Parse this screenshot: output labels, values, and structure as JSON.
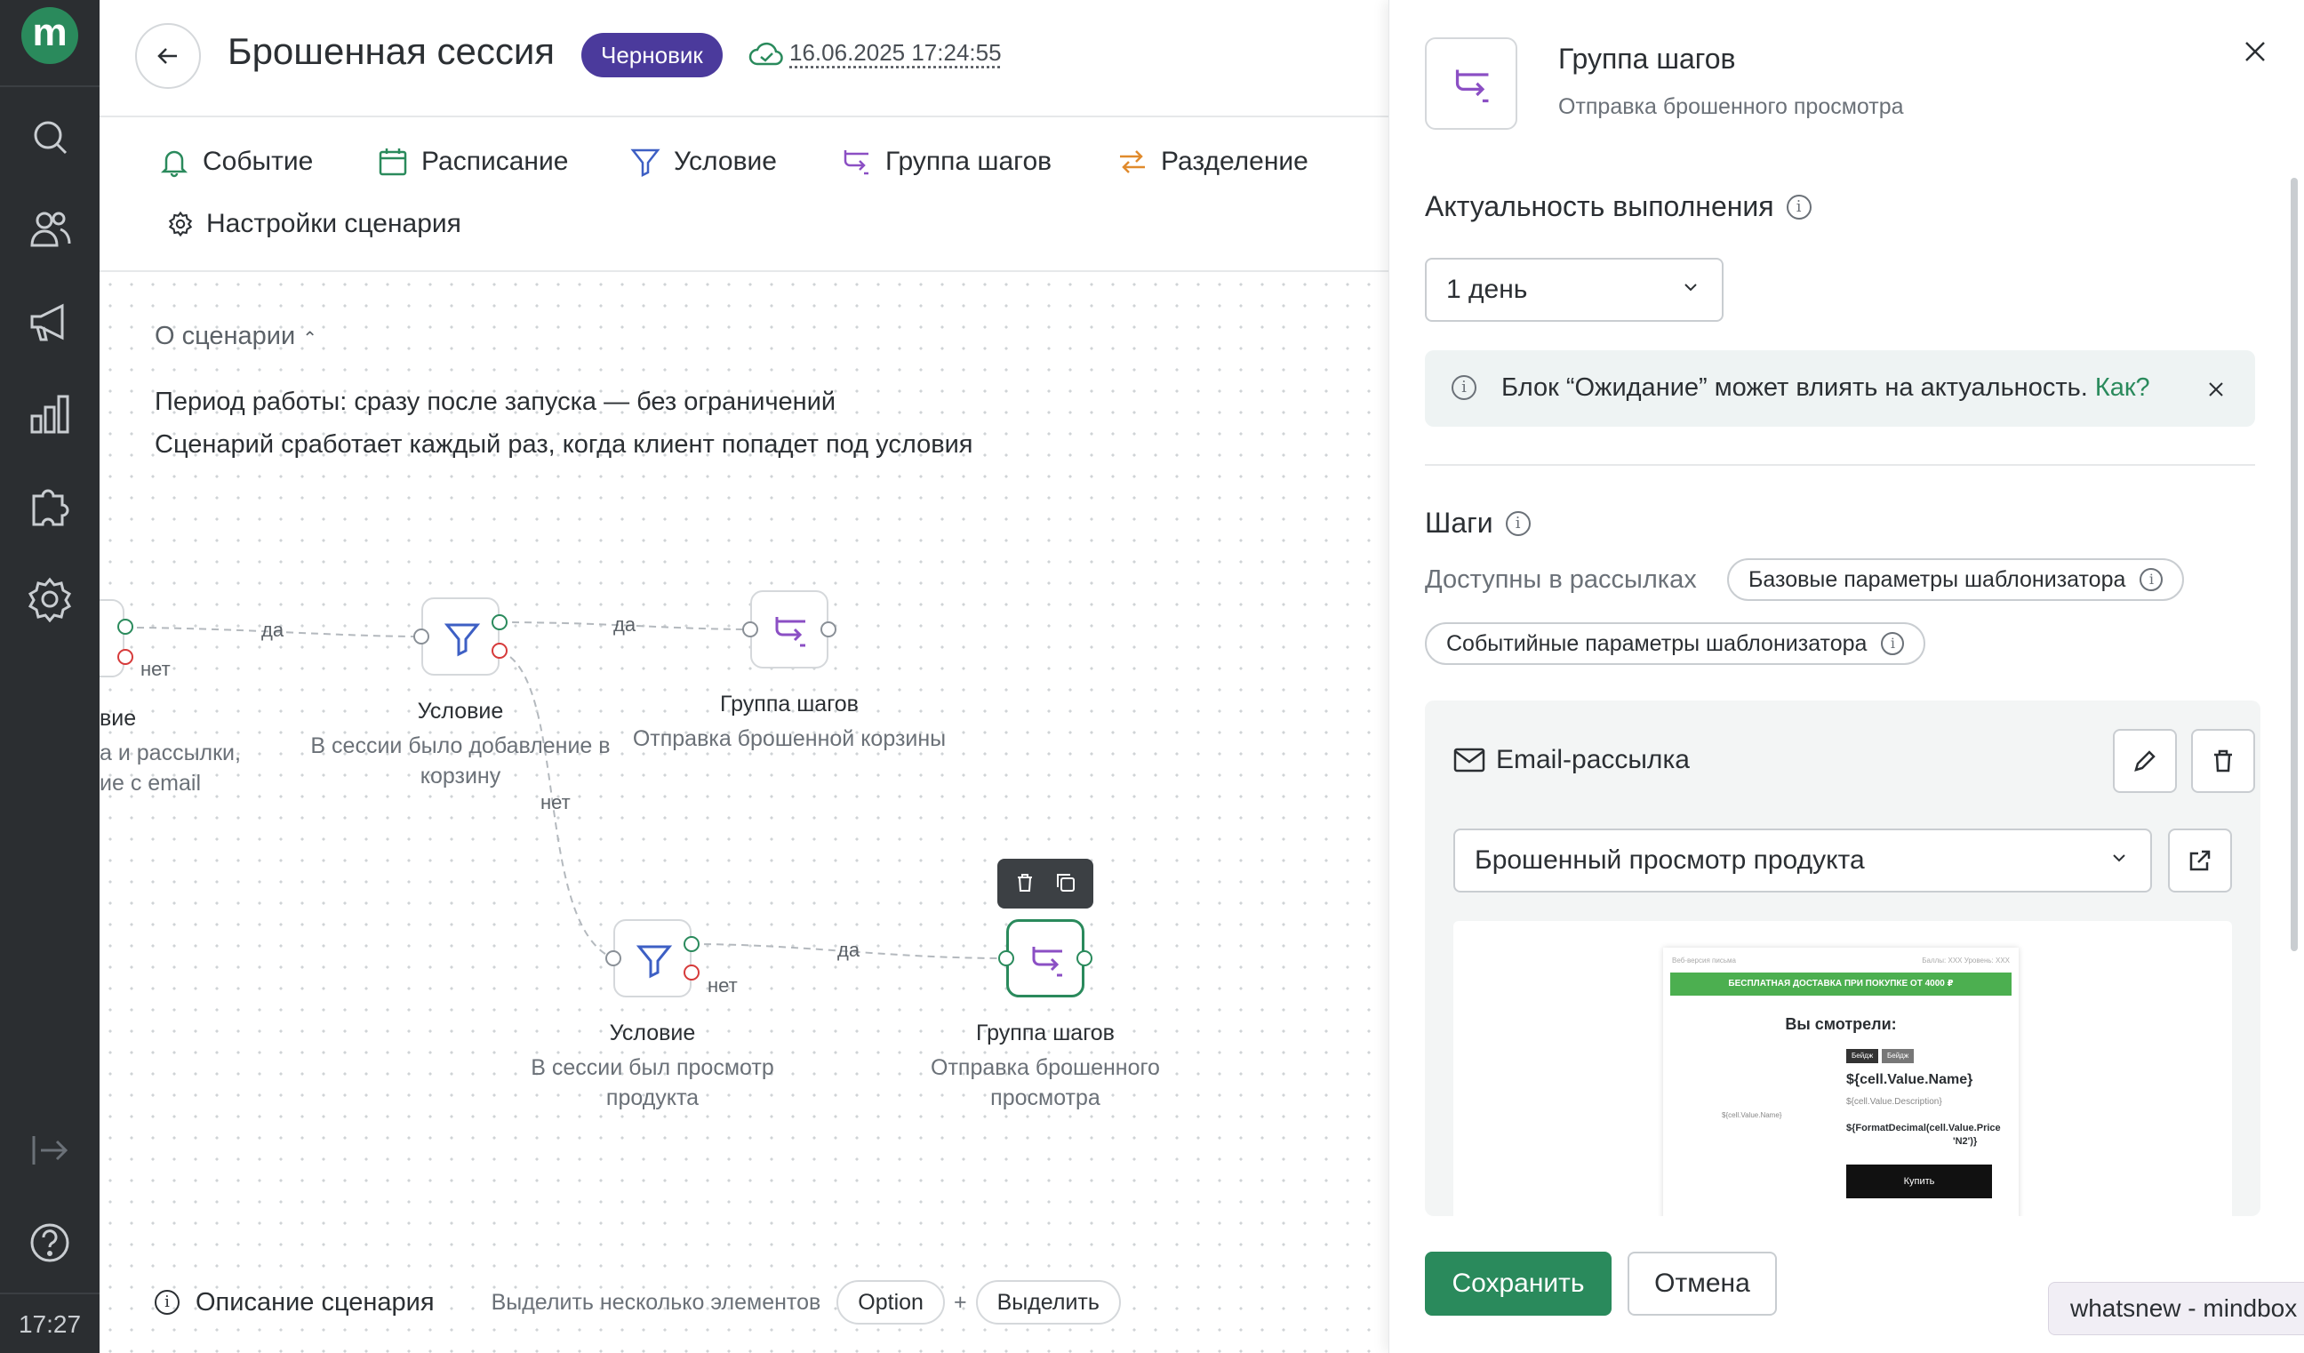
{
  "sidebar": {
    "logo": "m",
    "icons": [
      "search-icon",
      "users-icon",
      "megaphone-icon",
      "chart-icon",
      "puzzle-icon",
      "gear-icon",
      "logout-icon",
      "help-icon"
    ],
    "clock": "17:27"
  },
  "header": {
    "title": "Брошенная сессия",
    "status_badge": "Черновик",
    "saved_at": "16.06.2025 17:24:55"
  },
  "toolbar": {
    "items": [
      {
        "label": "Событие",
        "icon": "bell-icon"
      },
      {
        "label": "Расписание",
        "icon": "calendar-icon"
      },
      {
        "label": "Условие",
        "icon": "filter-icon"
      },
      {
        "label": "Группа шагов",
        "icon": "steps-icon"
      },
      {
        "label": "Разделение",
        "icon": "split-icon"
      }
    ],
    "settings_label": "Настройки сценария"
  },
  "about": {
    "title": "О сценарии",
    "lines": [
      "Период работы: сразу после запуска — без ограничений",
      "Сценарий сработает каждый раз, когда клиент попадет под условия"
    ]
  },
  "flow": {
    "partial_node": {
      "title": "вие",
      "sub1": "а и рассылки,",
      "sub2": "ие с email"
    },
    "nodes": [
      {
        "title": "Условие",
        "sub": "В сессии было добавление в корзину"
      },
      {
        "title": "Группа шагов",
        "sub": "Отправка брошенной корзины"
      },
      {
        "title": "Условие",
        "sub": "В сессии был просмотр продукта"
      },
      {
        "title": "Группа шагов",
        "sub": "Отправка брошенного просмотра"
      }
    ],
    "edge_labels": {
      "yes": "да",
      "no": "нет"
    }
  },
  "bottom": {
    "description_label": "Описание сценария",
    "multi_select_hint": "Выделить несколько элементов",
    "key_option": "Option",
    "plus": "+",
    "key_select": "Выделить"
  },
  "panel": {
    "title": "Группа шагов",
    "subtitle": "Отправка брошенного просмотра",
    "relevance_title": "Актуальность выполнения",
    "relevance_value": "1 день",
    "alert_text": "Блок “Ожидание” может влиять на актуальность.",
    "alert_link": "Как?",
    "steps_title": "Шаги",
    "available_label": "Доступны в рассылках",
    "chips": [
      "Базовые параметры шаблонизатора",
      "Событийные параметры шаблонизатора"
    ],
    "card_title": "Email-рассылка",
    "template_value": "Брошенный просмотр продукта",
    "email_preview": {
      "top_left": "Веб-версия письма",
      "top_right": "Баллы: XXX   Уровень: XXX",
      "banner": "БЕСПЛАТНАЯ ДОСТАВКА ПРИ ПОКУПКЕ ОТ 4000 ₽",
      "heading": "Вы смотрели:",
      "badges": [
        "Бейдж",
        "Бейдж"
      ],
      "name": "${cell.Value.Name}",
      "desc": "${cell.Value.Description}",
      "price": "${FormatDecimal(cell.Value.Price",
      "price2": "'N2')}",
      "img_alt": "${cell.Value.Name}",
      "buy": "Купить"
    },
    "save_label": "Сохранить",
    "cancel_label": "Отмена"
  },
  "tooltip": "whatsnew - mindbox"
}
